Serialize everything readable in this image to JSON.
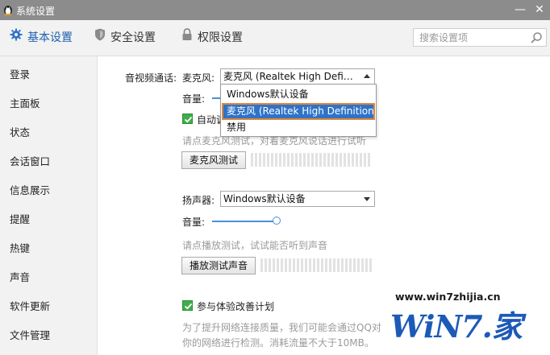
{
  "window": {
    "title": "系统设置",
    "min_glyph": "—",
    "close_glyph": "✕"
  },
  "tabs": [
    {
      "label": "基本设置",
      "icon": "gear-icon",
      "active": true
    },
    {
      "label": "安全设置",
      "icon": "shield-icon"
    },
    {
      "label": "权限设置",
      "icon": "lock-icon"
    }
  ],
  "search": {
    "placeholder": "搜索设置项",
    "icon": "search-icon"
  },
  "sidebar": {
    "items": [
      {
        "label": "登录"
      },
      {
        "label": "主面板"
      },
      {
        "label": "状态"
      },
      {
        "label": "会话窗口"
      },
      {
        "label": "信息展示"
      },
      {
        "label": "提醒"
      },
      {
        "label": "热键"
      },
      {
        "label": "声音"
      },
      {
        "label": "软件更新"
      },
      {
        "label": "文件管理"
      }
    ]
  },
  "av": {
    "section_label": "音视频通话:",
    "mic": {
      "label": "麦克风:",
      "selected": "麦克风 (Realtek High Definition Audio)",
      "options": [
        "Windows默认设备",
        "麦克风 (Realtek High Definition Audio)",
        "禁用"
      ],
      "volume_label": "音量:",
      "auto_label": "自动调",
      "test_hint": "请点麦克风测试，对着麦克风说话进行试听",
      "test_button": "麦克风测试"
    },
    "speaker": {
      "label": "扬声器:",
      "selected": "Windows默认设备",
      "volume_label": "音量:",
      "volume_level": 0.8,
      "test_hint": "请点播放测试，试试能否听到声音",
      "test_button": "播放测试声音"
    }
  },
  "experience": {
    "checkbox_label": "参与体验改善计划",
    "checked": true,
    "desc_line1": "为了提升网络连接质量，我们可能会通过QQ对",
    "desc_line2": "你的网络进行检测。消耗流量不大于10MB。"
  },
  "watermark": {
    "url": "www.win7zhijia.cn",
    "logo": "WiN7.家"
  },
  "colors": {
    "titlebar": "#8c8c8c",
    "accent": "#2f73c8",
    "check": "#3fae49",
    "highlight_outline": "#e0873a"
  }
}
